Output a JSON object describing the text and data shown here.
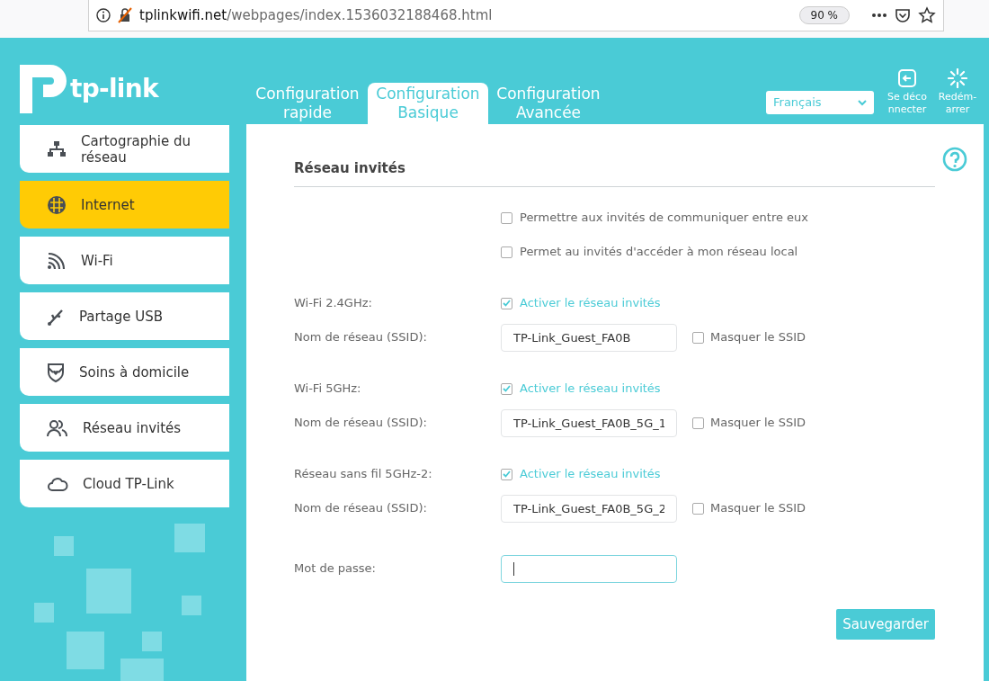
{
  "browser": {
    "url": "**tplinkwifi.net**/webpages/index.1536032188468.html",
    "zoom": "90 %"
  },
  "header": {
    "logo": "tp-link",
    "tabs": [
      {
        "label": "Configuration rapide",
        "selected": false
      },
      {
        "label": "Configuration Basique",
        "selected": true
      },
      {
        "label": "Configuration Avancée",
        "selected": false
      }
    ],
    "language": "Français",
    "actions": [
      {
        "kind": "logout",
        "label": "Se déconnecter"
      },
      {
        "kind": "reboot",
        "label": "Redém-arrer"
      }
    ]
  },
  "sidebar": {
    "items": [
      {
        "kind": "map",
        "label": "Cartographie du réseau",
        "selected": false
      },
      {
        "kind": "globe",
        "label": "Internet",
        "selected": true
      },
      {
        "kind": "wifi",
        "label": "Wi-Fi",
        "selected": false
      },
      {
        "kind": "usb",
        "label": "Partage USB",
        "selected": false
      },
      {
        "kind": "shield",
        "label": "Soins à domicile",
        "selected": false
      },
      {
        "kind": "guests",
        "label": "Réseau invités",
        "selected": false
      },
      {
        "kind": "cloud",
        "label": "Cloud TP-Link",
        "selected": false
      }
    ]
  },
  "panel": {
    "title": "Réseau invités",
    "groups": [
      [
        {
          "kind": "option",
          "text": "Permettre aux invités de communiquer entre eux",
          "checked": false
        },
        {
          "kind": "option",
          "text": "Permet au invités d'accéder à mon réseau local",
          "checked": false
        }
      ],
      [
        {
          "kind": "band",
          "label": "Wi-Fi 2.4GHz:",
          "text": "Activer le réseau invités",
          "checked": true
        },
        {
          "kind": "ssid",
          "label": "Nom de réseau (SSID):",
          "value": "TP-Link_Guest_FA0B",
          "hide_label": "Masquer le SSID",
          "checked": false
        }
      ],
      [
        {
          "kind": "band",
          "label": "Wi-Fi 5GHz:",
          "text": "Activer le réseau invités",
          "checked": true
        },
        {
          "kind": "ssid",
          "label": "Nom de réseau (SSID):",
          "value": "TP-Link_Guest_FA0B_5G_1",
          "hide_label": "Masquer le SSID",
          "checked": false
        }
      ],
      [
        {
          "kind": "band",
          "label": "Réseau sans fil 5GHz-2:",
          "text": "Activer le réseau invités",
          "checked": true
        },
        {
          "kind": "ssid",
          "label": "Nom de réseau (SSID):",
          "value": "TP-Link_Guest_FA0B_5G_2",
          "hide_label": "Masquer le SSID",
          "checked": false
        }
      ],
      [
        {
          "kind": "password",
          "label": "Mot de passe:",
          "focused": true
        }
      ]
    ],
    "save": "Sauvegarder"
  }
}
